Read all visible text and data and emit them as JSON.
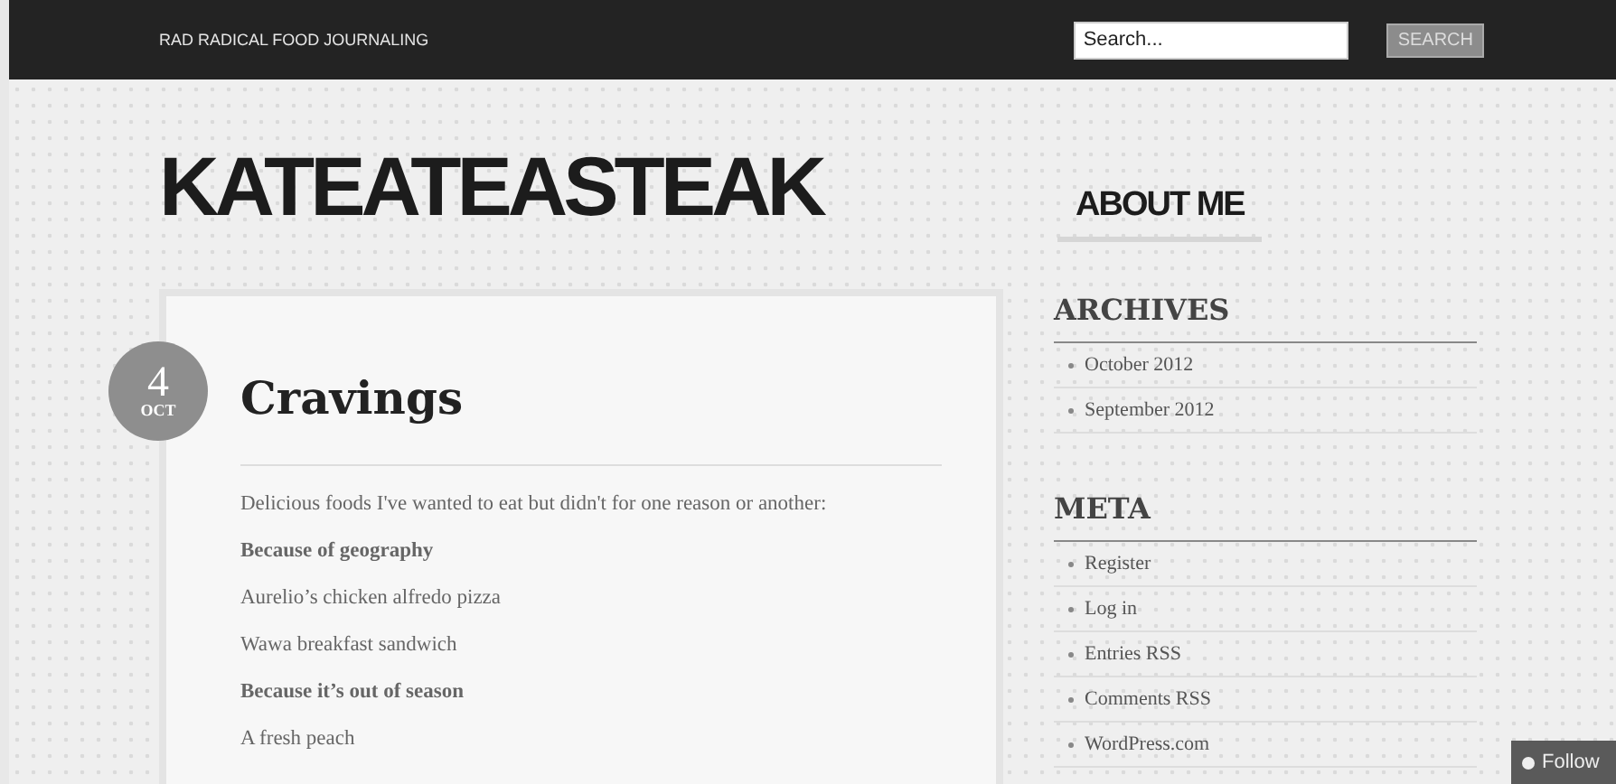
{
  "top_bar": {
    "tagline": "RAD RADICAL FOOD JOURNALING",
    "search": {
      "placeholder": "Search..."
    },
    "search_button": "SEARCH"
  },
  "site_title": "KATEATEASTEAK",
  "nav": [
    {
      "label": "ABOUT ME",
      "selected": true
    }
  ],
  "post": {
    "date": {
      "day": "4",
      "month": "OCT"
    },
    "title": "Cravings",
    "body": [
      {
        "kind": "paragraph",
        "text": "Delicious foods I've wanted to eat but didn't for one reason or another:"
      },
      {
        "kind": "heading",
        "text": "Because of geography"
      },
      {
        "kind": "paragraph",
        "text": "Aurelio’s chicken alfredo pizza"
      },
      {
        "kind": "paragraph",
        "text": "Wawa breakfast sandwich"
      },
      {
        "kind": "heading",
        "text": "Because it’s out of season"
      },
      {
        "kind": "paragraph",
        "text": "A fresh peach"
      }
    ]
  },
  "sidebar": [
    {
      "title": "ARCHIVES",
      "items": [
        "October 2012",
        "September 2012"
      ]
    },
    {
      "title": "META",
      "items": [
        "Register",
        "Log in",
        "Entries RSS",
        "Comments RSS",
        "WordPress.com"
      ]
    }
  ],
  "follow_button": "Follow"
}
